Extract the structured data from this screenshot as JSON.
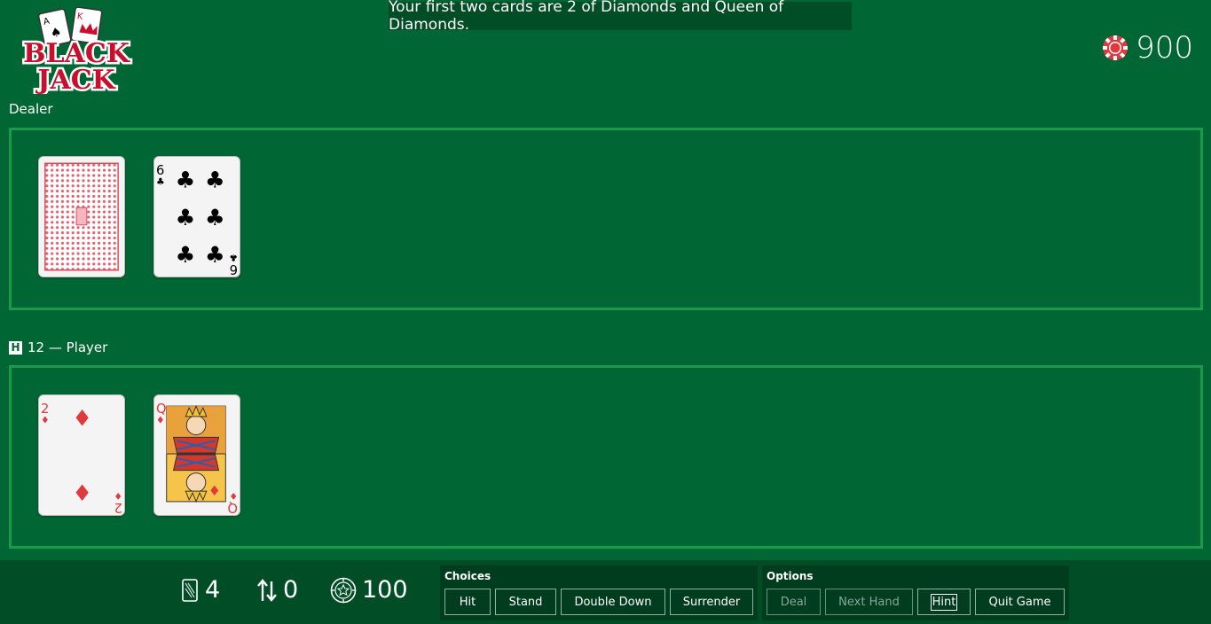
{
  "announcement": "Your first two cards are 2 of Diamonds and Queen of Diamonds.",
  "logo": {
    "line1": "BLACK",
    "line2": "JACK"
  },
  "chips": {
    "amount": "900"
  },
  "dealer": {
    "label": "Dealer",
    "cards": [
      {
        "name": "face-down-card"
      },
      {
        "name": "six-of-clubs",
        "rank": "6",
        "suit": "clubs"
      }
    ]
  },
  "player": {
    "badge": "H",
    "label": "12 — Player",
    "cards": [
      {
        "name": "two-of-diamonds",
        "rank": "2",
        "suit": "diamonds"
      },
      {
        "name": "queen-of-diamonds",
        "rank": "Q",
        "suit": "diamonds"
      }
    ]
  },
  "stats": {
    "deck": "4",
    "hands": "0",
    "bet": "100"
  },
  "choices": {
    "title": "Choices",
    "hit": "Hit",
    "stand": "Stand",
    "double_down": "Double Down",
    "surrender": "Surrender"
  },
  "options": {
    "title": "Options",
    "deal": "Deal",
    "next_hand": "Next Hand",
    "hint": "Hint",
    "quit_game": "Quit Game"
  },
  "colors": {
    "felt": "#006633",
    "bar": "#004d26",
    "border": "#1a9a4a",
    "red": "#e03a3e"
  }
}
